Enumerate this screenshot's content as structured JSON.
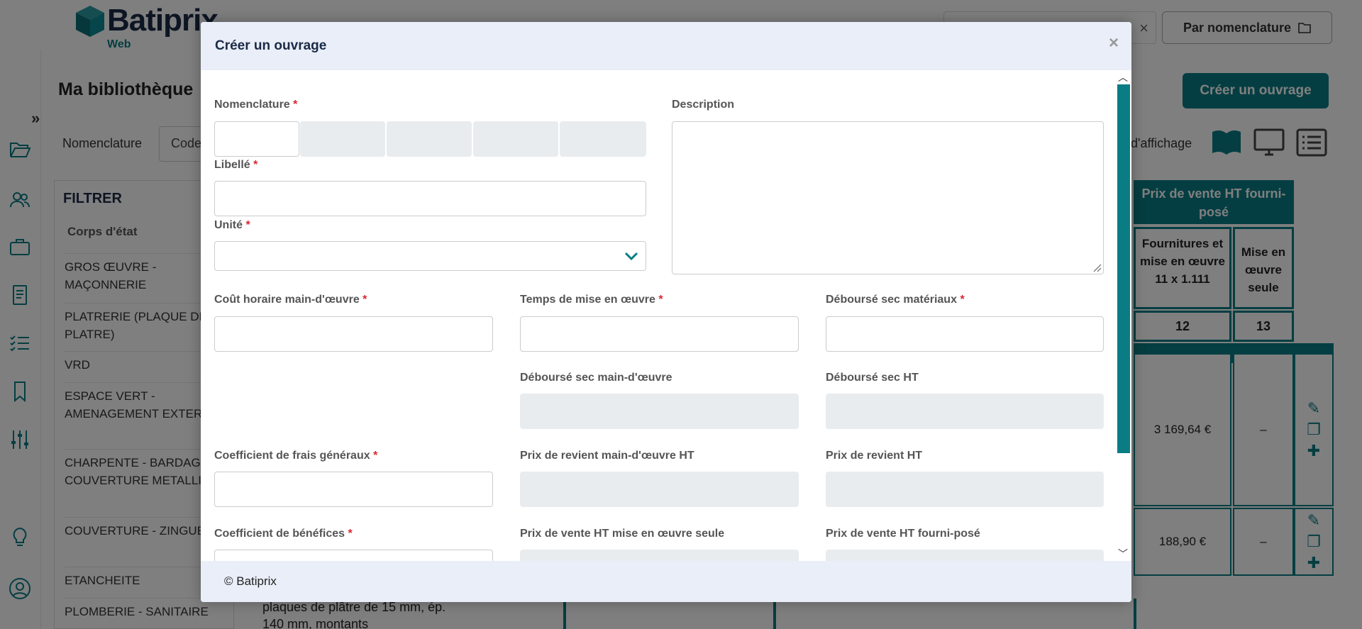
{
  "app": {
    "logo_text": "Batiprix",
    "logo_sub": "Web",
    "top_button": "Par nomenclature",
    "page_title": "Ma bibliothèque",
    "create_button": "Créer un ouvrage",
    "filter_row_label": "Nomenclature",
    "code_select": "Code",
    "affichage_label": "d'affichage",
    "filter": {
      "title": "FILTRER",
      "subtitle": "Corps d'état",
      "items": [
        "GROS ŒUVRE - MAÇONNERIE",
        "PLATRERIE (PLAQUE DE PLATRE)",
        "VRD",
        "ESPACE VERT - AMENAGEMENT EXTERIEUR",
        "CHARPENTE - BARDAGE ET COUVERTURE METALLIQUE",
        "COUVERTURE - ZINGUERIE",
        "ETANCHEITE",
        "PLOMBERIE - SANITAIRE"
      ]
    },
    "table": {
      "header_group": "Prix de vente HT fourni-posé",
      "col_12_label": "Fournitures et mise en œuvre 11 x 1.111",
      "col_13_label": "Mise en œuvre seule",
      "col_12_num": "12",
      "col_13_num": "13",
      "rows": [
        {
          "fourni": "3 169,64 €",
          "seule": "–"
        },
        {
          "fourni": "188,90 €",
          "seule": "–"
        }
      ],
      "partial_desc": "plaques de plâtre de 15 mm, ép. 140 mm, montants"
    }
  },
  "modal": {
    "title": "Créer un ouvrage",
    "close_symbol": "×",
    "footer": "© Batiprix",
    "required_mark": "*",
    "fields": {
      "nomenclature": "Nomenclature",
      "libelle": "Libellé",
      "unite": "Unité",
      "description": "Description",
      "cout_horaire": "Coût horaire main-d'œuvre",
      "temps_mise": "Temps de mise en œuvre",
      "debourse_materiaux": "Déboursé sec matériaux",
      "debourse_mo": "Déboursé sec main-d'œuvre",
      "debourse_ht": "Déboursé sec HT",
      "coef_frais": "Coefficient de frais généraux",
      "prix_revient_mo": "Prix de revient main-d'œuvre HT",
      "prix_revient_ht": "Prix de revient HT",
      "coef_benefices": "Coefficient de bénéfices",
      "prix_vente_seule": "Prix de vente HT mise en œuvre seule",
      "prix_vente_fourni": "Prix de vente HT fourni-posé"
    }
  },
  "colors": {
    "teal": "#0a7d84",
    "navy": "#1b2a47",
    "required": "#d9262f",
    "readonly_bg": "#e9ecef",
    "modal_header_bg": "#e9eef8"
  }
}
